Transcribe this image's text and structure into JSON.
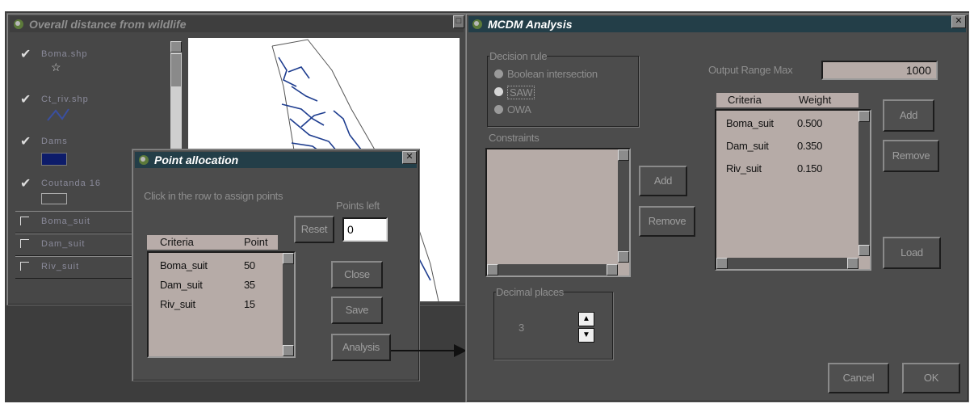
{
  "layers_window": {
    "title": "Overall distance from wildlife",
    "layers": [
      {
        "name": "Boma.shp",
        "checked": true
      },
      {
        "name": "Ct_riv.shp",
        "checked": true
      },
      {
        "name": "Dams",
        "checked": true
      },
      {
        "name": "Coutanda 16",
        "checked": true
      },
      {
        "name": "Boma_suit",
        "checked": false
      },
      {
        "name": "Dam_suit",
        "checked": false
      },
      {
        "name": "Riv_suit",
        "checked": false
      }
    ],
    "colors": {
      "river": "#1e3d8f",
      "dams": "#0d1c6a"
    }
  },
  "point_allocation": {
    "title": "Point allocation",
    "instruction": "Click in the row to assign points",
    "points_left_label": "Points left",
    "points_left_value": "0",
    "reset_label": "Reset",
    "columns": [
      "Criteria",
      "Point"
    ],
    "rows": [
      {
        "criteria": "Boma_suit",
        "value": "50"
      },
      {
        "criteria": "Dam_suit",
        "value": "35"
      },
      {
        "criteria": "Riv_suit",
        "value": "15"
      }
    ],
    "close_label": "Close",
    "save_label": "Save",
    "analysis_label": "Analysis"
  },
  "mcdm": {
    "title": "MCDM Analysis",
    "decision_rule_label": "Decision rule",
    "rules": [
      "Boolean intersection",
      "SAW",
      "OWA"
    ],
    "selected_rule": "SAW",
    "constraints_label": "Constraints",
    "add_label": "Add",
    "remove_label": "Remove",
    "decimal_label": "Decimal places",
    "decimal_value": "3",
    "output_range_label": "Output Range Max",
    "output_range_value": "1000",
    "columns": [
      "Criteria",
      "Weight"
    ],
    "rows": [
      {
        "criteria": "Boma_suit",
        "weight": "0.500"
      },
      {
        "criteria": "Dam_suit",
        "weight": "0.350"
      },
      {
        "criteria": "Riv_suit",
        "weight": "0.150"
      }
    ],
    "weights_add_label": "Add",
    "weights_remove_label": "Remove",
    "load_label": "Load",
    "cancel_label": "Cancel",
    "ok_label": "OK"
  },
  "colors": {
    "titlebar": "#233e48",
    "list_bg": "#b6aba7",
    "dialog_bg": "#4c4c4c"
  }
}
